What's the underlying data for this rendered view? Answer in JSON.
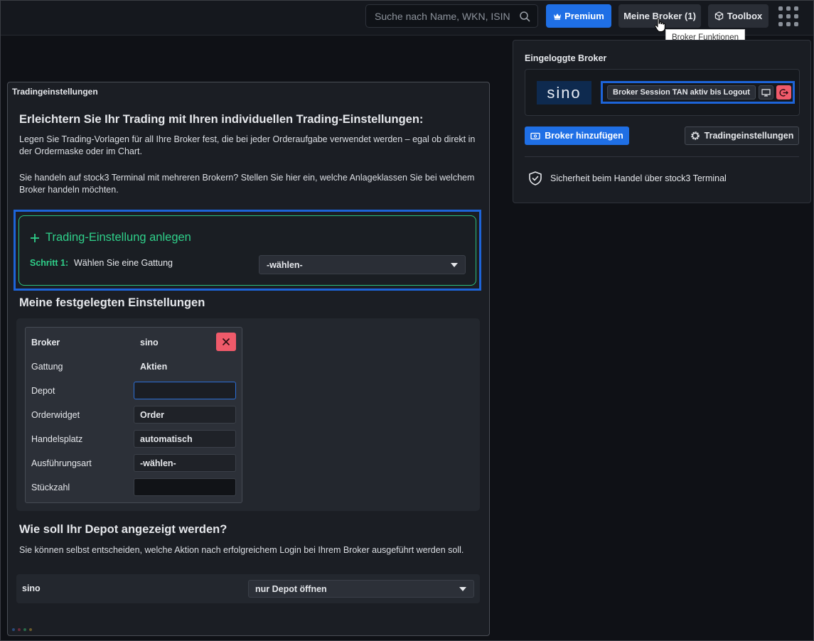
{
  "topbar": {
    "search_placeholder": "Suche nach Name, WKN, ISIN",
    "premium_label": "Premium",
    "my_broker_label": "Meine Broker (1)",
    "toolbox_label": "Toolbox",
    "tooltip": "Broker Funktionen"
  },
  "broker_panel": {
    "title": "Eingeloggte Broker",
    "broker_logo_text": "sino",
    "session_label": "Broker Session TAN aktiv bis Logout",
    "add_broker_label": "Broker hinzufügen",
    "trading_settings_label": "Tradingeinstellungen",
    "security_text": "Sicherheit beim Handel über stock3 Terminal"
  },
  "panel": {
    "title": "Tradingeinstellungen",
    "heading": "Erleichtern Sie Ihr Trading mit Ihren individuellen Trading-Einstellungen:",
    "paragraph1": "Legen Sie Trading-Vorlagen für all Ihre Broker fest, die bei jeder Orderaufgabe verwendet werden – egal ob direkt in der Ordermaske oder im Chart.",
    "paragraph2": "Sie handeln auf stock3 Terminal mit mehreren Brokern? Stellen Sie hier ein, welche Anlageklassen Sie bei welchem Broker handeln möchten.",
    "create": {
      "title": "Trading-Einstellung anlegen",
      "step_label": "Schritt 1:",
      "step_text": "Wählen Sie eine Gattung",
      "select_value": "-wählen-"
    },
    "settings_heading": "Meine festgelegten Einstellungen",
    "settings": {
      "broker_label": "Broker",
      "broker_value": "sino",
      "genus_label": "Gattung",
      "genus_value": "Aktien",
      "depot_label": "Depot",
      "depot_value": "",
      "orderwidget_label": "Orderwidget",
      "orderwidget_value": "Order",
      "venue_label": "Handelsplatz",
      "venue_value": "automatisch",
      "execution_label": "Ausführungsart",
      "execution_value": "-wählen-",
      "quantity_label": "Stückzahl",
      "quantity_value": ""
    },
    "depot_heading": "Wie soll Ihr Depot angezeigt werden?",
    "depot_text": "Sie können selbst entscheiden, welche Aktion nach erfolgreichem Login bei Ihrem Broker ausgeführt werden soll.",
    "depot_broker": "sino",
    "depot_action": "nur Depot öffnen"
  },
  "colors": {
    "accent_blue": "#1f6fe5",
    "accent_green": "#2fd08a",
    "danger_red": "#ef5a6a",
    "highlight_blue": "#1d64d8"
  }
}
